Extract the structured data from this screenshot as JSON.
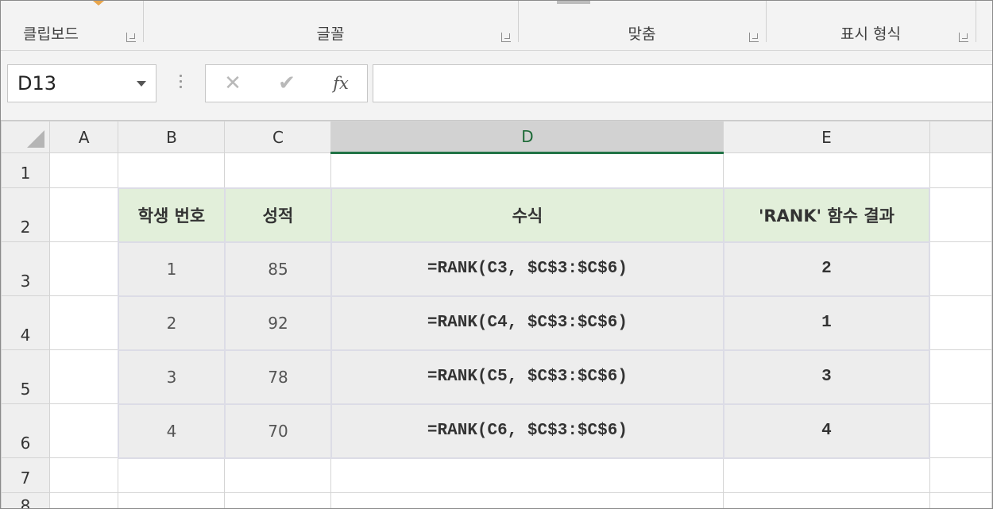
{
  "ribbon": {
    "groups": [
      {
        "label": "클립보드"
      },
      {
        "label": "글꼴"
      },
      {
        "label": "맞춤"
      },
      {
        "label": "표시 형식"
      }
    ]
  },
  "formula_bar": {
    "name_box": "D13",
    "cancel_icon": "✕",
    "enter_icon": "✔",
    "fx_label": "fx",
    "formula": ""
  },
  "columns": [
    "A",
    "B",
    "C",
    "D",
    "E"
  ],
  "rows": [
    {
      "num": "1",
      "cells": [
        "",
        "",
        "",
        "",
        ""
      ]
    },
    {
      "num": "2",
      "cells": [
        "",
        "학생 번호",
        "성적",
        "수식",
        "'RANK' 함수 결과"
      ]
    },
    {
      "num": "3",
      "cells": [
        "",
        "1",
        "85",
        "=RANK(C3, $C$3:$C$6)",
        "2"
      ]
    },
    {
      "num": "4",
      "cells": [
        "",
        "2",
        "92",
        "=RANK(C4, $C$3:$C$6)",
        "1"
      ]
    },
    {
      "num": "5",
      "cells": [
        "",
        "3",
        "78",
        "=RANK(C5, $C$3:$C$6)",
        "3"
      ]
    },
    {
      "num": "6",
      "cells": [
        "",
        "4",
        "70",
        "=RANK(C6, $C$3:$C$6)",
        "4"
      ]
    },
    {
      "num": "7",
      "cells": [
        "",
        "",
        "",
        "",
        ""
      ]
    },
    {
      "num": "8",
      "cells": [
        "",
        "",
        "",
        "",
        ""
      ]
    }
  ],
  "selected_column": "D",
  "colors": {
    "header_fill": "#e2efda",
    "data_fill": "#ededed",
    "accent": "#217346"
  }
}
